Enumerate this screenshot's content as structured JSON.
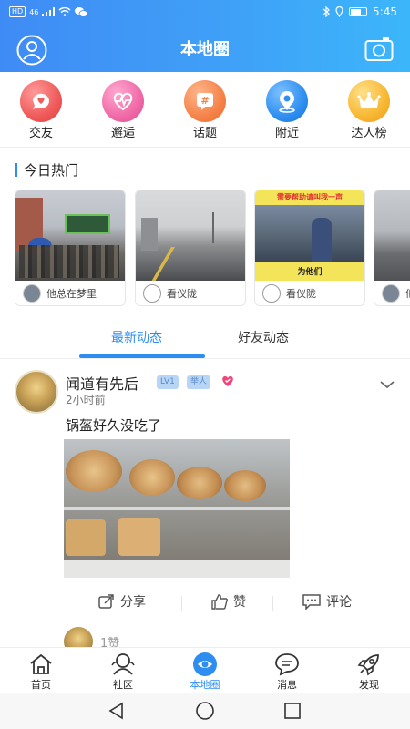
{
  "status_bar": {
    "network": "HD",
    "signal": "46",
    "time": "5:45"
  },
  "header": {
    "title": "本地圈"
  },
  "categories": [
    {
      "label": "交友",
      "icon": "heart-chat-icon",
      "color": "#ef5a5a"
    },
    {
      "label": "邂逅",
      "icon": "heartbeat-icon",
      "color": "#f06aa8"
    },
    {
      "label": "话题",
      "icon": "hashtag-icon",
      "color": "#f5834a"
    },
    {
      "label": "附近",
      "icon": "location-pin-icon",
      "color": "#2f8ff0"
    },
    {
      "label": "达人榜",
      "icon": "crown-icon",
      "color": "#f7b733"
    }
  ],
  "hot_today": {
    "title": "今日热门",
    "cards": [
      {
        "user": "他总在梦里"
      },
      {
        "user": "看仪陇"
      },
      {
        "user": "看仪陇",
        "banner": "需要帮助请叫我一声",
        "caption": "为他们"
      },
      {
        "user": "他"
      }
    ]
  },
  "tabs": {
    "active": "最新动态",
    "inactive": "好友动态"
  },
  "post": {
    "author": "闻道有先后",
    "level": "LV1",
    "role": "举人",
    "time": "2小时前",
    "text": "锅盔好久没吃了",
    "actions": {
      "share": "分享",
      "like": "赞",
      "comment": "评论"
    },
    "likes": "1赞"
  },
  "bottom_nav": [
    {
      "label": "首页",
      "icon": "home-icon"
    },
    {
      "label": "社区",
      "icon": "community-icon"
    },
    {
      "label": "本地圈",
      "icon": "local-circle-icon"
    },
    {
      "label": "消息",
      "icon": "message-icon"
    },
    {
      "label": "发现",
      "icon": "rocket-icon"
    }
  ],
  "colors": {
    "brand": "#2e8ef0",
    "header_start": "#3f8bf5",
    "header_end": "#3cb6fa"
  }
}
